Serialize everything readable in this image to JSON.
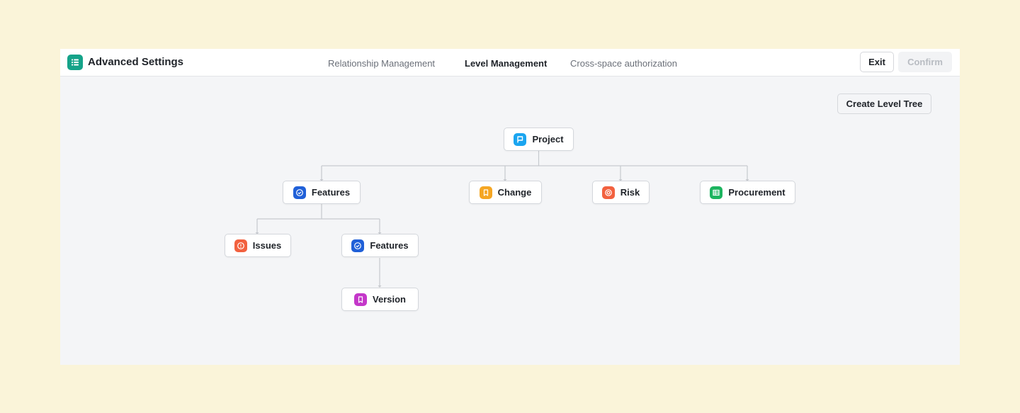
{
  "app": {
    "title": "Advanced Settings",
    "icon": "list-icon"
  },
  "tabs": [
    {
      "label": "Relationship Management",
      "active": false
    },
    {
      "label": "Level Management",
      "active": true
    },
    {
      "label": "Cross-space authorization",
      "active": false
    }
  ],
  "actions": {
    "exit_label": "Exit",
    "confirm_label": "Confirm",
    "confirm_disabled": true
  },
  "toolbar": {
    "create_label": "Create Level Tree"
  },
  "tree": {
    "root": {
      "label": "Project",
      "icon": "flag-icon",
      "color": "#1aa5f0"
    },
    "level1": [
      {
        "label": "Features",
        "icon": "check-circle-icon",
        "color": "#2060d8"
      },
      {
        "label": "Change",
        "icon": "bookmark-icon",
        "color": "#f5a623"
      },
      {
        "label": "Risk",
        "icon": "target-icon",
        "color": "#f2613f"
      },
      {
        "label": "Procurement",
        "icon": "table-icon",
        "color": "#1cb45f"
      }
    ],
    "level2": [
      {
        "label": "Issues",
        "icon": "alert-circle-icon",
        "color": "#f2613f"
      },
      {
        "label": "Features",
        "icon": "check-circle-icon",
        "color": "#2060d8"
      }
    ],
    "level3": [
      {
        "label": "Version",
        "icon": "bookmark-icon",
        "color": "#c437c9"
      }
    ]
  }
}
